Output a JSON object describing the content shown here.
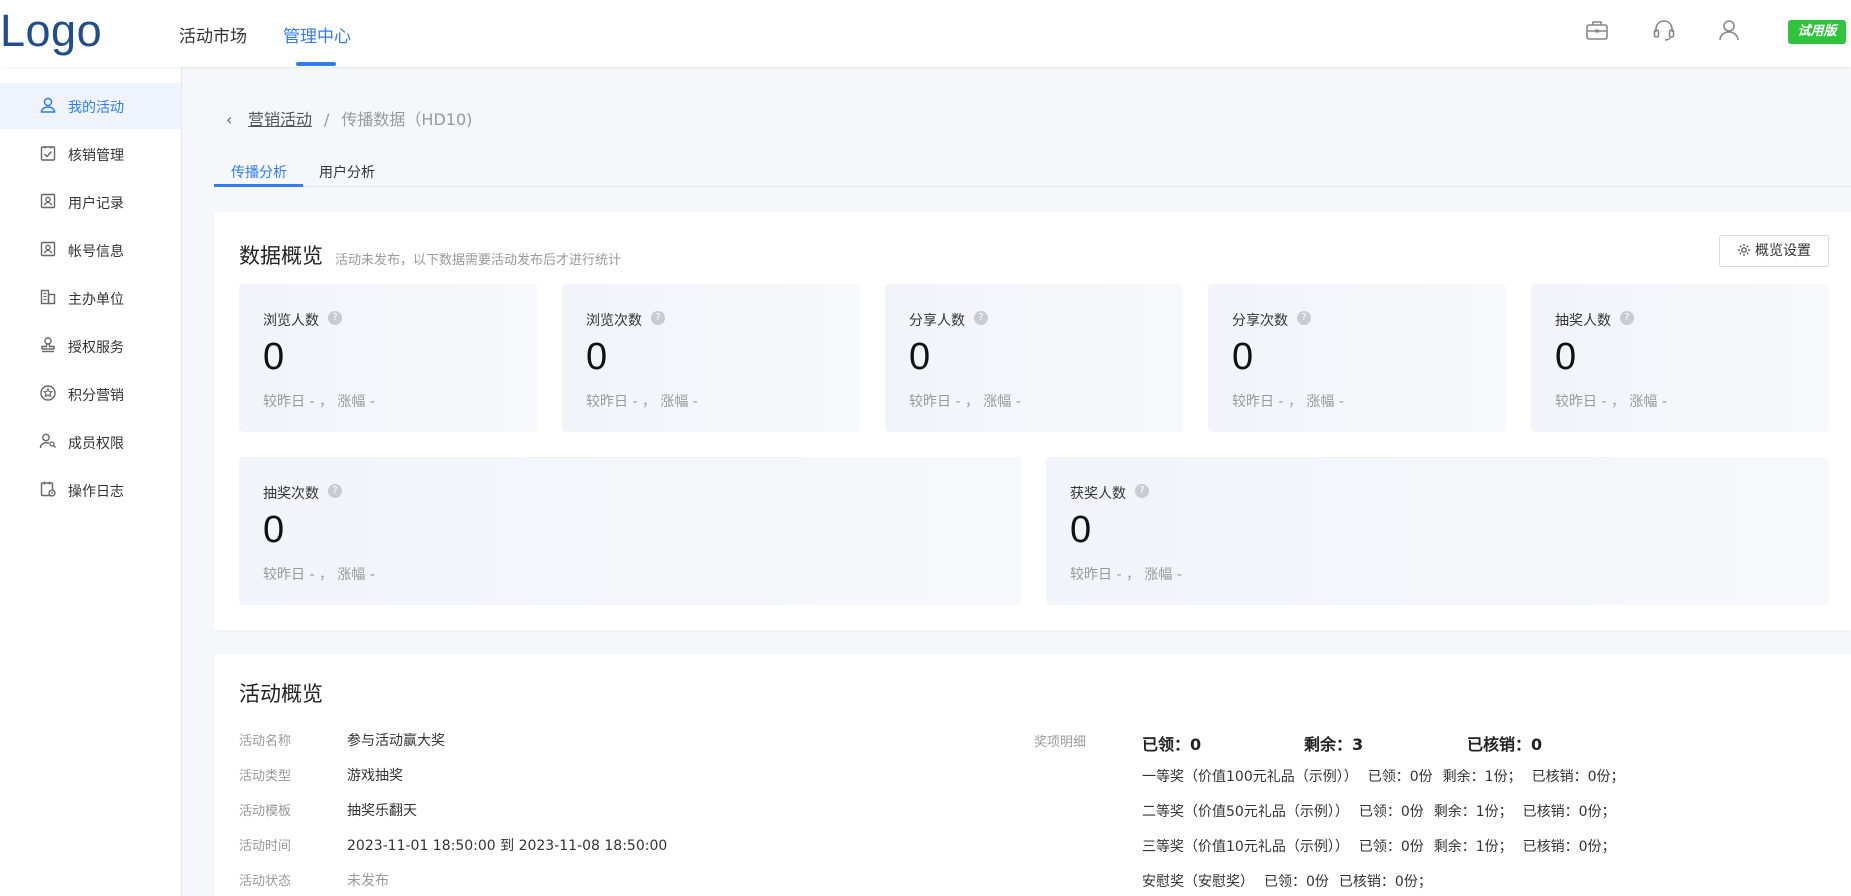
{
  "app": {
    "logo": "Logo",
    "trial_badge": "试用版",
    "nav": [
      {
        "label": "活动市场"
      },
      {
        "label": "管理中心"
      }
    ],
    "top_icons": [
      "briefcase-icon",
      "headset-icon",
      "user-icon"
    ]
  },
  "sidebar": {
    "items": [
      {
        "label": "我的活动",
        "icon": "user-icon",
        "active": true
      },
      {
        "label": "核销管理",
        "icon": "checklist-icon"
      },
      {
        "label": "用户记录",
        "icon": "user-card-icon"
      },
      {
        "label": "帐号信息",
        "icon": "account-card-icon"
      },
      {
        "label": "主办单位",
        "icon": "building-icon"
      },
      {
        "label": "授权服务",
        "icon": "stamp-icon"
      },
      {
        "label": "积分营销",
        "icon": "star-badge-icon"
      },
      {
        "label": "成员权限",
        "icon": "user-key-icon"
      },
      {
        "label": "操作日志",
        "icon": "calendar-log-icon"
      }
    ]
  },
  "breadcrumb": {
    "parent": "营销活动",
    "separator": "/",
    "current": "传播数据（HD10)"
  },
  "tabs": [
    {
      "label": "传播分析",
      "active": true
    },
    {
      "label": "用户分析"
    }
  ],
  "overview": {
    "title": "数据概览",
    "subtitle": "活动未发布，以下数据需要活动发布后才进行统计",
    "settings_label": "概览设置",
    "help_glyph": "?",
    "stats_row1": [
      {
        "label": "浏览人数",
        "value": "0",
        "trend": "较昨日 - ，  涨幅 -"
      },
      {
        "label": "浏览次数",
        "value": "0",
        "trend": "较昨日 - ，  涨幅 -"
      },
      {
        "label": "分享人数",
        "value": "0",
        "trend": "较昨日 - ，  涨幅 -"
      },
      {
        "label": "分享次数",
        "value": "0",
        "trend": "较昨日 - ，  涨幅 -"
      },
      {
        "label": "抽奖人数",
        "value": "0",
        "trend": "较昨日 - ，  涨幅 -"
      }
    ],
    "stats_row2": [
      {
        "label": "抽奖次数",
        "value": "0",
        "trend": "较昨日 - ，  涨幅 -"
      },
      {
        "label": "获奖人数",
        "value": "0",
        "trend": "较昨日 - ，  涨幅 -"
      }
    ]
  },
  "activity": {
    "title": "活动概览",
    "fields": [
      {
        "label": "活动名称",
        "value": "参与活动赢大奖"
      },
      {
        "label": "活动类型",
        "value": "游戏抽奖"
      },
      {
        "label": "活动模板",
        "value": "抽奖乐翻天"
      },
      {
        "label": "活动时间",
        "value": "2023-11-01 18:50:00 到 2023-11-08 18:50:00"
      },
      {
        "label": "活动状态",
        "value": "未发布"
      }
    ],
    "prize_label": "奖项明细",
    "prize_summary": {
      "received": "已领：0",
      "remaining": "剩余：3",
      "redeemed": "已核销：0"
    },
    "prizes": [
      {
        "name": "一等奖（价值100元礼品（示例））",
        "received": "已领：0份",
        "remaining": "剩余：1份；",
        "redeemed": "已核销：0份；"
      },
      {
        "name": "二等奖（价值50元礼品（示例））",
        "received": "已领：0份",
        "remaining": "剩余：1份；",
        "redeemed": "已核销：0份；"
      },
      {
        "name": "三等奖（价值10元礼品（示例））",
        "received": "已领：0份",
        "remaining": "剩余：1份；",
        "redeemed": "已核销：0份；"
      },
      {
        "name": "安慰奖（安慰奖）",
        "received": "已领：0份",
        "remaining": "",
        "redeemed": "已核销：0份；"
      }
    ]
  },
  "colors": {
    "accent": "#2f7cf6",
    "trial_badge": "#2fc43c",
    "logo": "#1f4e8c"
  }
}
